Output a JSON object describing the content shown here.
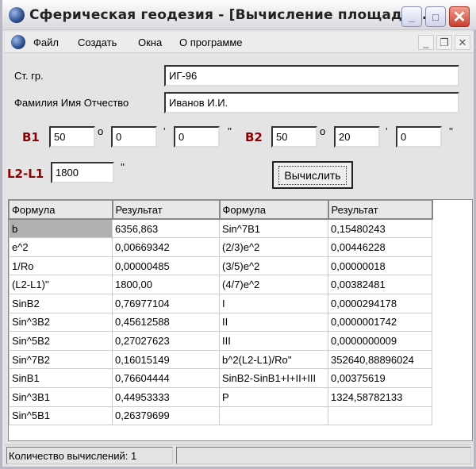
{
  "window": {
    "title": "Сферическая геодезия - [Вычисление площади ..."
  },
  "menu": [
    "Файл",
    "Создать",
    "Окна",
    "О программе"
  ],
  "form": {
    "group_label": "Ст. гр.",
    "group_value": "ИГ-96",
    "name_label": "Фамилия Имя  Отчество",
    "name_value": "Иванов И.И.",
    "b1_label": "B1",
    "b1_deg": "50",
    "b1_min": "0",
    "b1_sec": "0",
    "b2_label": "B2",
    "b2_deg": "50",
    "b2_min": "20",
    "b2_sec": "0",
    "l_label": "L2-L1",
    "l_value": "1800",
    "deg_sym": "o",
    "min_sym": "'",
    "sec_sym": "''",
    "calc_button": "Вычислить"
  },
  "table": {
    "headers": [
      "Формула",
      "Результат",
      "Формула",
      "Результат"
    ],
    "rows": [
      [
        "b",
        "6356,863",
        "Sin^7B1",
        "0,15480243"
      ],
      [
        "e^2",
        "0,00669342",
        "(2/3)e^2",
        "0,00446228"
      ],
      [
        "1/Ro",
        "0,00000485",
        "(3/5)e^2",
        "0,00000018"
      ],
      [
        "(L2-L1)''",
        "1800,00",
        "(4/7)e^2",
        "0,00382481"
      ],
      [
        "SinB2",
        "0,76977104",
        "I",
        "0,0000294178"
      ],
      [
        "Sin^3B2",
        "0,45612588",
        "II",
        "0,0000001742"
      ],
      [
        "Sin^5B2",
        "0,27027623",
        "III",
        "0,0000000009"
      ],
      [
        "Sin^7B2",
        "0,16015149",
        "b^2(L2-L1)/Ro''",
        "352640,88896024"
      ],
      [
        "SinB1",
        "0,76604444",
        "SinB2-SinB1+I+II+III",
        "0,00375619"
      ],
      [
        "Sin^3B1",
        "0,44953333",
        "P",
        "1324,58782133"
      ],
      [
        "Sin^5B1",
        "0,26379699",
        "",
        ""
      ]
    ]
  },
  "status": {
    "count": "Количество вычислений: 1"
  }
}
